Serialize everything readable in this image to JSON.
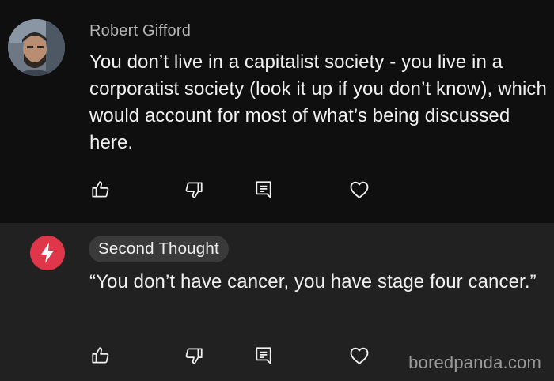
{
  "comments": [
    {
      "author": "Robert Gifford",
      "avatar_icon": "user-avatar-photo",
      "text": "You don’t live in a capitalist society - you live in a corporatist society (look it up if you don’t know), which would account for most of what’s being discussed here.",
      "actions": [
        "thumbs-up-icon",
        "thumbs-down-icon",
        "reply-icon",
        "heart-icon"
      ]
    },
    {
      "author": "Second Thought",
      "avatar_icon": "lightning-bolt-icon",
      "text": "“You don’t have cancer, you have stage four cancer.”",
      "actions": [
        "thumbs-up-icon",
        "thumbs-down-icon",
        "reply-icon",
        "heart-icon"
      ]
    }
  ],
  "watermark": "boredpanda.com",
  "colors": {
    "background": "#0f0f0f",
    "reply_background": "#212121",
    "channel_accent": "#e0364a",
    "chip_background": "#3a3a3a",
    "secondary_text": "#b5b5b5"
  }
}
